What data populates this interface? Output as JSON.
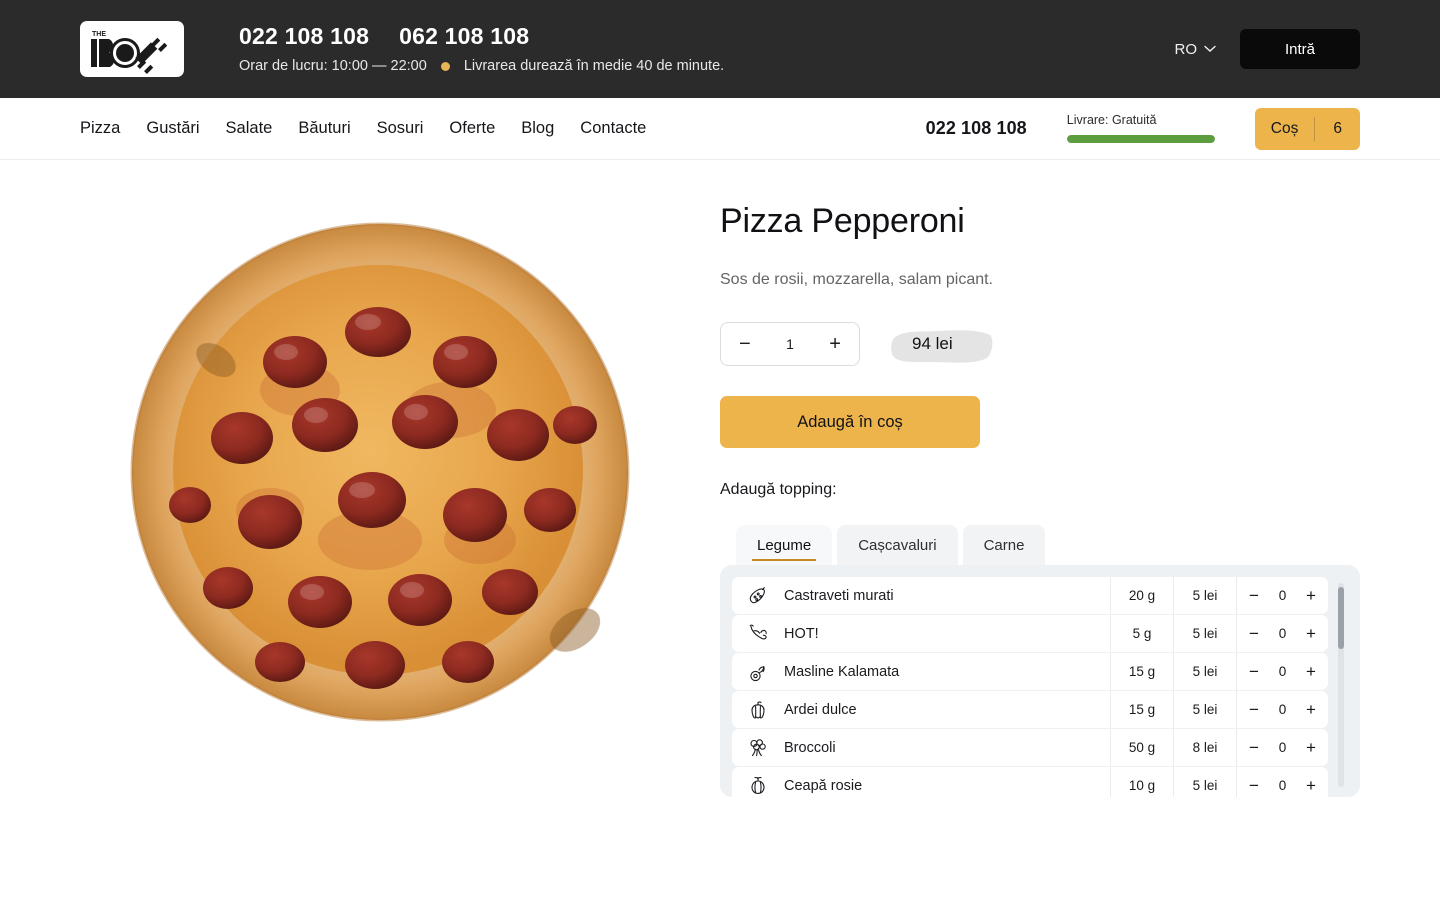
{
  "topbar": {
    "logo_text_top": "THE",
    "logo_text_main": "BOX",
    "phone1": "022 108 108",
    "phone2": "062 108 108",
    "hours": "Orar de lucru: 10:00 — 22:00",
    "delivery_note": "Livrarea durează în medie 40 de minute.",
    "lang": "RO",
    "login_label": "Intră",
    "bg_color": "#2b2b2b",
    "dot_color": "#e8b458"
  },
  "nav": {
    "links": [
      {
        "label": "Pizza"
      },
      {
        "label": "Gustări"
      },
      {
        "label": "Salate"
      },
      {
        "label": "Băuturi"
      },
      {
        "label": "Sosuri"
      },
      {
        "label": "Oferte"
      },
      {
        "label": "Blog"
      },
      {
        "label": "Contacte"
      }
    ],
    "phone": "022 108 108",
    "delivery_label": "Livrare: Gratuită",
    "delivery_progress": 100,
    "progress_color": "#5c9e3f",
    "cart_label": "Coș",
    "cart_count": "6",
    "cart_color": "#edb44c"
  },
  "product": {
    "title": "Pizza Pepperoni",
    "description": "Sos de rosii, mozzarella, salam picant.",
    "image_alt": "pepperoni-pizza",
    "quantity": "1",
    "decrease_label": "−",
    "increase_label": "+",
    "price": "94 lei",
    "add_to_cart_label": "Adaugă în coș",
    "accent_color": "#edb44c"
  },
  "toppings": {
    "section_label": "Adaugă topping:",
    "tabs": [
      {
        "label": "Legume",
        "active": true
      },
      {
        "label": "Cașcavaluri",
        "active": false
      },
      {
        "label": "Carne",
        "active": false
      }
    ],
    "active_tab_underline": "#c78a21",
    "rows": [
      {
        "icon": "pickle-icon",
        "name": "Castraveti murati",
        "weight": "20 g",
        "price": "5 lei",
        "qty": "0"
      },
      {
        "icon": "chili-icon",
        "name": "HOT!",
        "weight": "5 g",
        "price": "5 lei",
        "qty": "0"
      },
      {
        "icon": "olive-icon",
        "name": "Masline Kalamata",
        "weight": "15 g",
        "price": "5 lei",
        "qty": "0"
      },
      {
        "icon": "pepper-icon",
        "name": "Ardei dulce",
        "weight": "15 g",
        "price": "5 lei",
        "qty": "0"
      },
      {
        "icon": "broccoli-icon",
        "name": "Broccoli",
        "weight": "50 g",
        "price": "8 lei",
        "qty": "0"
      },
      {
        "icon": "onion-icon",
        "name": "Ceapă rosie",
        "weight": "10 g",
        "price": "5 lei",
        "qty": "0"
      }
    ],
    "minus_label": "−",
    "plus_label": "+"
  }
}
